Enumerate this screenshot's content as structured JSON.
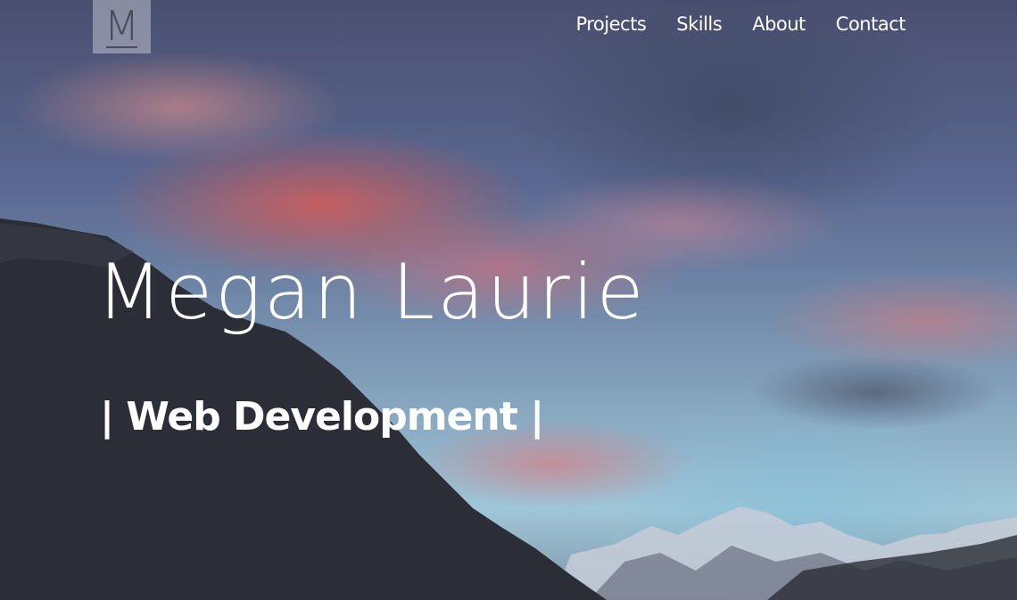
{
  "logo": {
    "letter": "M"
  },
  "nav": {
    "items": [
      {
        "label": "Projects"
      },
      {
        "label": "Skills"
      },
      {
        "label": "About"
      },
      {
        "label": "Contact"
      }
    ]
  },
  "hero": {
    "title": "Megan Laurie",
    "subtitle": "| Web Development |"
  }
}
